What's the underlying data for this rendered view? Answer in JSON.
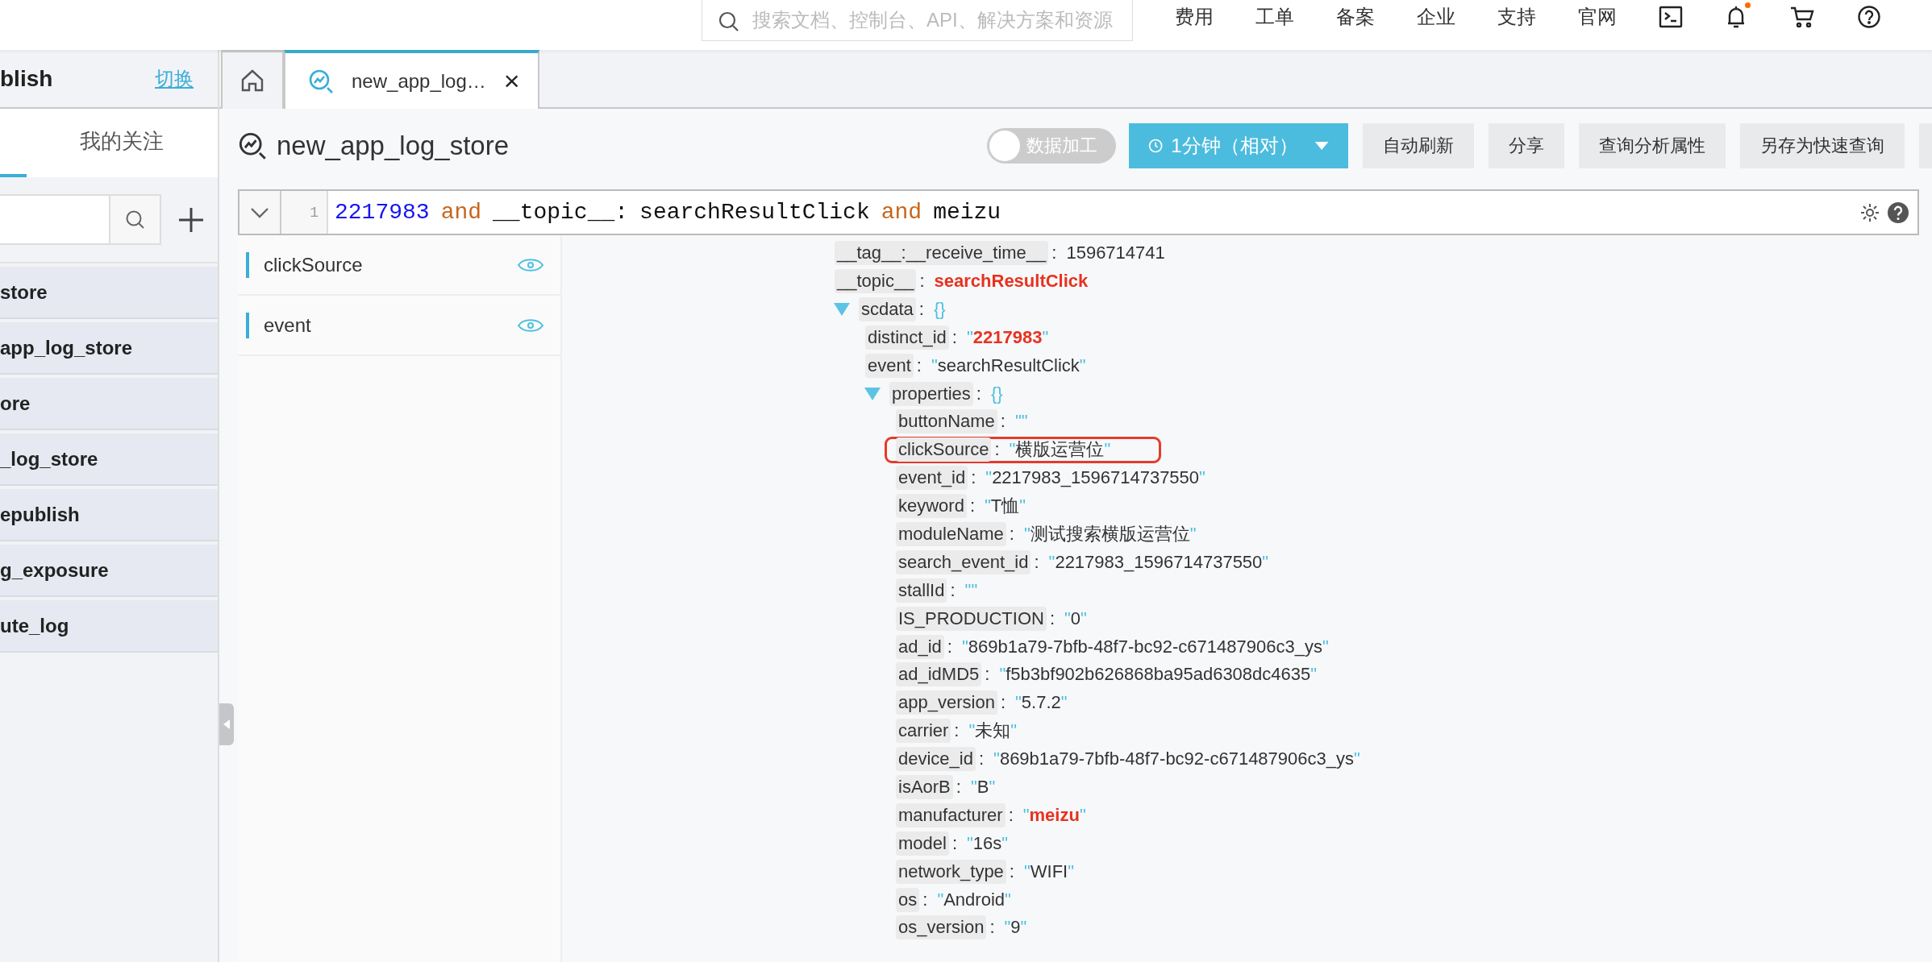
{
  "top_bar": {
    "search": {
      "placeholder": "搜索文档、控制台、API、解决方案和资源"
    },
    "nav": [
      "费用",
      "工单",
      "备案",
      "企业",
      "支持",
      "官网"
    ],
    "icons": [
      {
        "kind": "terminal",
        "badge": false
      },
      {
        "kind": "bell",
        "badge": true
      },
      {
        "kind": "cart",
        "badge": false
      },
      {
        "kind": "help",
        "badge": false
      }
    ]
  },
  "sidebar": {
    "title": "blish",
    "switch_link": "切换",
    "tabs": [
      {
        "selected": true
      },
      {
        "label": "我的关注",
        "selected": false
      }
    ],
    "items": [
      "store",
      "app_log_store",
      "ore",
      "_log_store",
      "epublish",
      "g_exposure",
      "ute_log"
    ]
  },
  "tabs": [
    {
      "kind": "home",
      "selected": false
    },
    {
      "kind": "logstore",
      "label": "new_app_log…",
      "close": "×",
      "selected": true
    }
  ],
  "toolbar": {
    "title": "new_app_log_store",
    "toggle": {
      "label": "数据加工",
      "on": false
    },
    "time_button": "1分钟（相对）",
    "buttons": [
      "自动刷新",
      "分享",
      "查询分析属性",
      "另存为快速查询"
    ]
  },
  "query": {
    "line_number": "1",
    "tokens": [
      {
        "text": "2217983",
        "kind": "number"
      },
      {
        "text": "and",
        "kind": "keyword"
      },
      {
        "text": "__topic__:",
        "kind": "plain"
      },
      {
        "text": "searchResultClick",
        "kind": "plain"
      },
      {
        "text": "and",
        "kind": "keyword"
      },
      {
        "text": "meizu",
        "kind": "plain"
      }
    ]
  },
  "fields": [
    "clickSource",
    "event"
  ],
  "log": {
    "entries": [
      {
        "key": "__tag__:__receive_time__",
        "sep": ":",
        "kind": "plain",
        "value": "1596714741",
        "highlight": false
      },
      {
        "key": "__topic__",
        "sep": ":",
        "kind": "plain",
        "value": "searchResultClick",
        "highlight": true
      },
      {
        "key": "scdata",
        "sep": ":",
        "kind": "object",
        "value": "{}",
        "expanded": true,
        "children": [
          {
            "key": "distinct_id",
            "sep": ":",
            "kind": "string",
            "value": "\"2217983\"",
            "highlight": true
          },
          {
            "key": "event",
            "sep": ":",
            "kind": "string",
            "value": "\"searchResultClick\"",
            "highlight": false
          },
          {
            "key": "properties",
            "sep": ":",
            "kind": "object",
            "value": "{}",
            "expanded": true,
            "children": [
              {
                "key": "buttonName",
                "sep": ":",
                "kind": "string",
                "value": "\"\"",
                "highlight": false
              },
              {
                "key": "clickSource",
                "sep": ":",
                "kind": "string",
                "value": "\"横版运营位\"",
                "highlight": false,
                "boxed": true
              },
              {
                "key": "event_id",
                "sep": ":",
                "kind": "string",
                "value": "\"2217983_1596714737550\"",
                "highlight": false
              },
              {
                "key": "keyword",
                "sep": ":",
                "kind": "string",
                "value": "\"T恤\"",
                "highlight": false
              },
              {
                "key": "moduleName",
                "sep": ":",
                "kind": "string",
                "value": "\"测试搜索横版运营位\"",
                "highlight": false
              },
              {
                "key": "search_event_id",
                "sep": ":",
                "kind": "string",
                "value": "\"2217983_1596714737550\"",
                "highlight": false
              },
              {
                "key": "stallId",
                "sep": ":",
                "kind": "string",
                "value": "\"\"",
                "highlight": false
              },
              {
                "key": "IS_PRODUCTION",
                "sep": ":",
                "kind": "string",
                "value": "\"0\"",
                "highlight": false
              },
              {
                "key": "ad_id",
                "sep": ":",
                "kind": "string",
                "value": "\"869b1a79-7bfb-48f7-bc92-c671487906c3_ys\"",
                "highlight": false
              },
              {
                "key": "ad_idMD5",
                "sep": ":",
                "kind": "string",
                "value": "\"f5b3bf902b626868ba95ad6308dc4635\"",
                "highlight": false
              },
              {
                "key": "app_version",
                "sep": ":",
                "kind": "string",
                "value": "\"5.7.2\"",
                "highlight": false
              },
              {
                "key": "carrier",
                "sep": ":",
                "kind": "string",
                "value": "\"未知\"",
                "highlight": false
              },
              {
                "key": "device_id",
                "sep": ":",
                "kind": "string",
                "value": "\"869b1a79-7bfb-48f7-bc92-c671487906c3_ys\"",
                "highlight": false
              },
              {
                "key": "isAorB",
                "sep": ":",
                "kind": "string",
                "value": "\"B\"",
                "highlight": false
              },
              {
                "key": "manufacturer",
                "sep": ":",
                "kind": "string",
                "value": "\"meizu\"",
                "highlight": true
              },
              {
                "key": "model",
                "sep": ":",
                "kind": "string",
                "value": "\"16s\"",
                "highlight": false
              },
              {
                "key": "network_type",
                "sep": ":",
                "kind": "string",
                "value": "\"WIFI\"",
                "highlight": false
              },
              {
                "key": "os",
                "sep": ":",
                "kind": "string",
                "value": "\"Android\"",
                "highlight": false
              },
              {
                "key": "os_version",
                "sep": ":",
                "kind": "string",
                "value": "\"9\"",
                "highlight": false
              }
            ]
          }
        ]
      }
    ]
  }
}
